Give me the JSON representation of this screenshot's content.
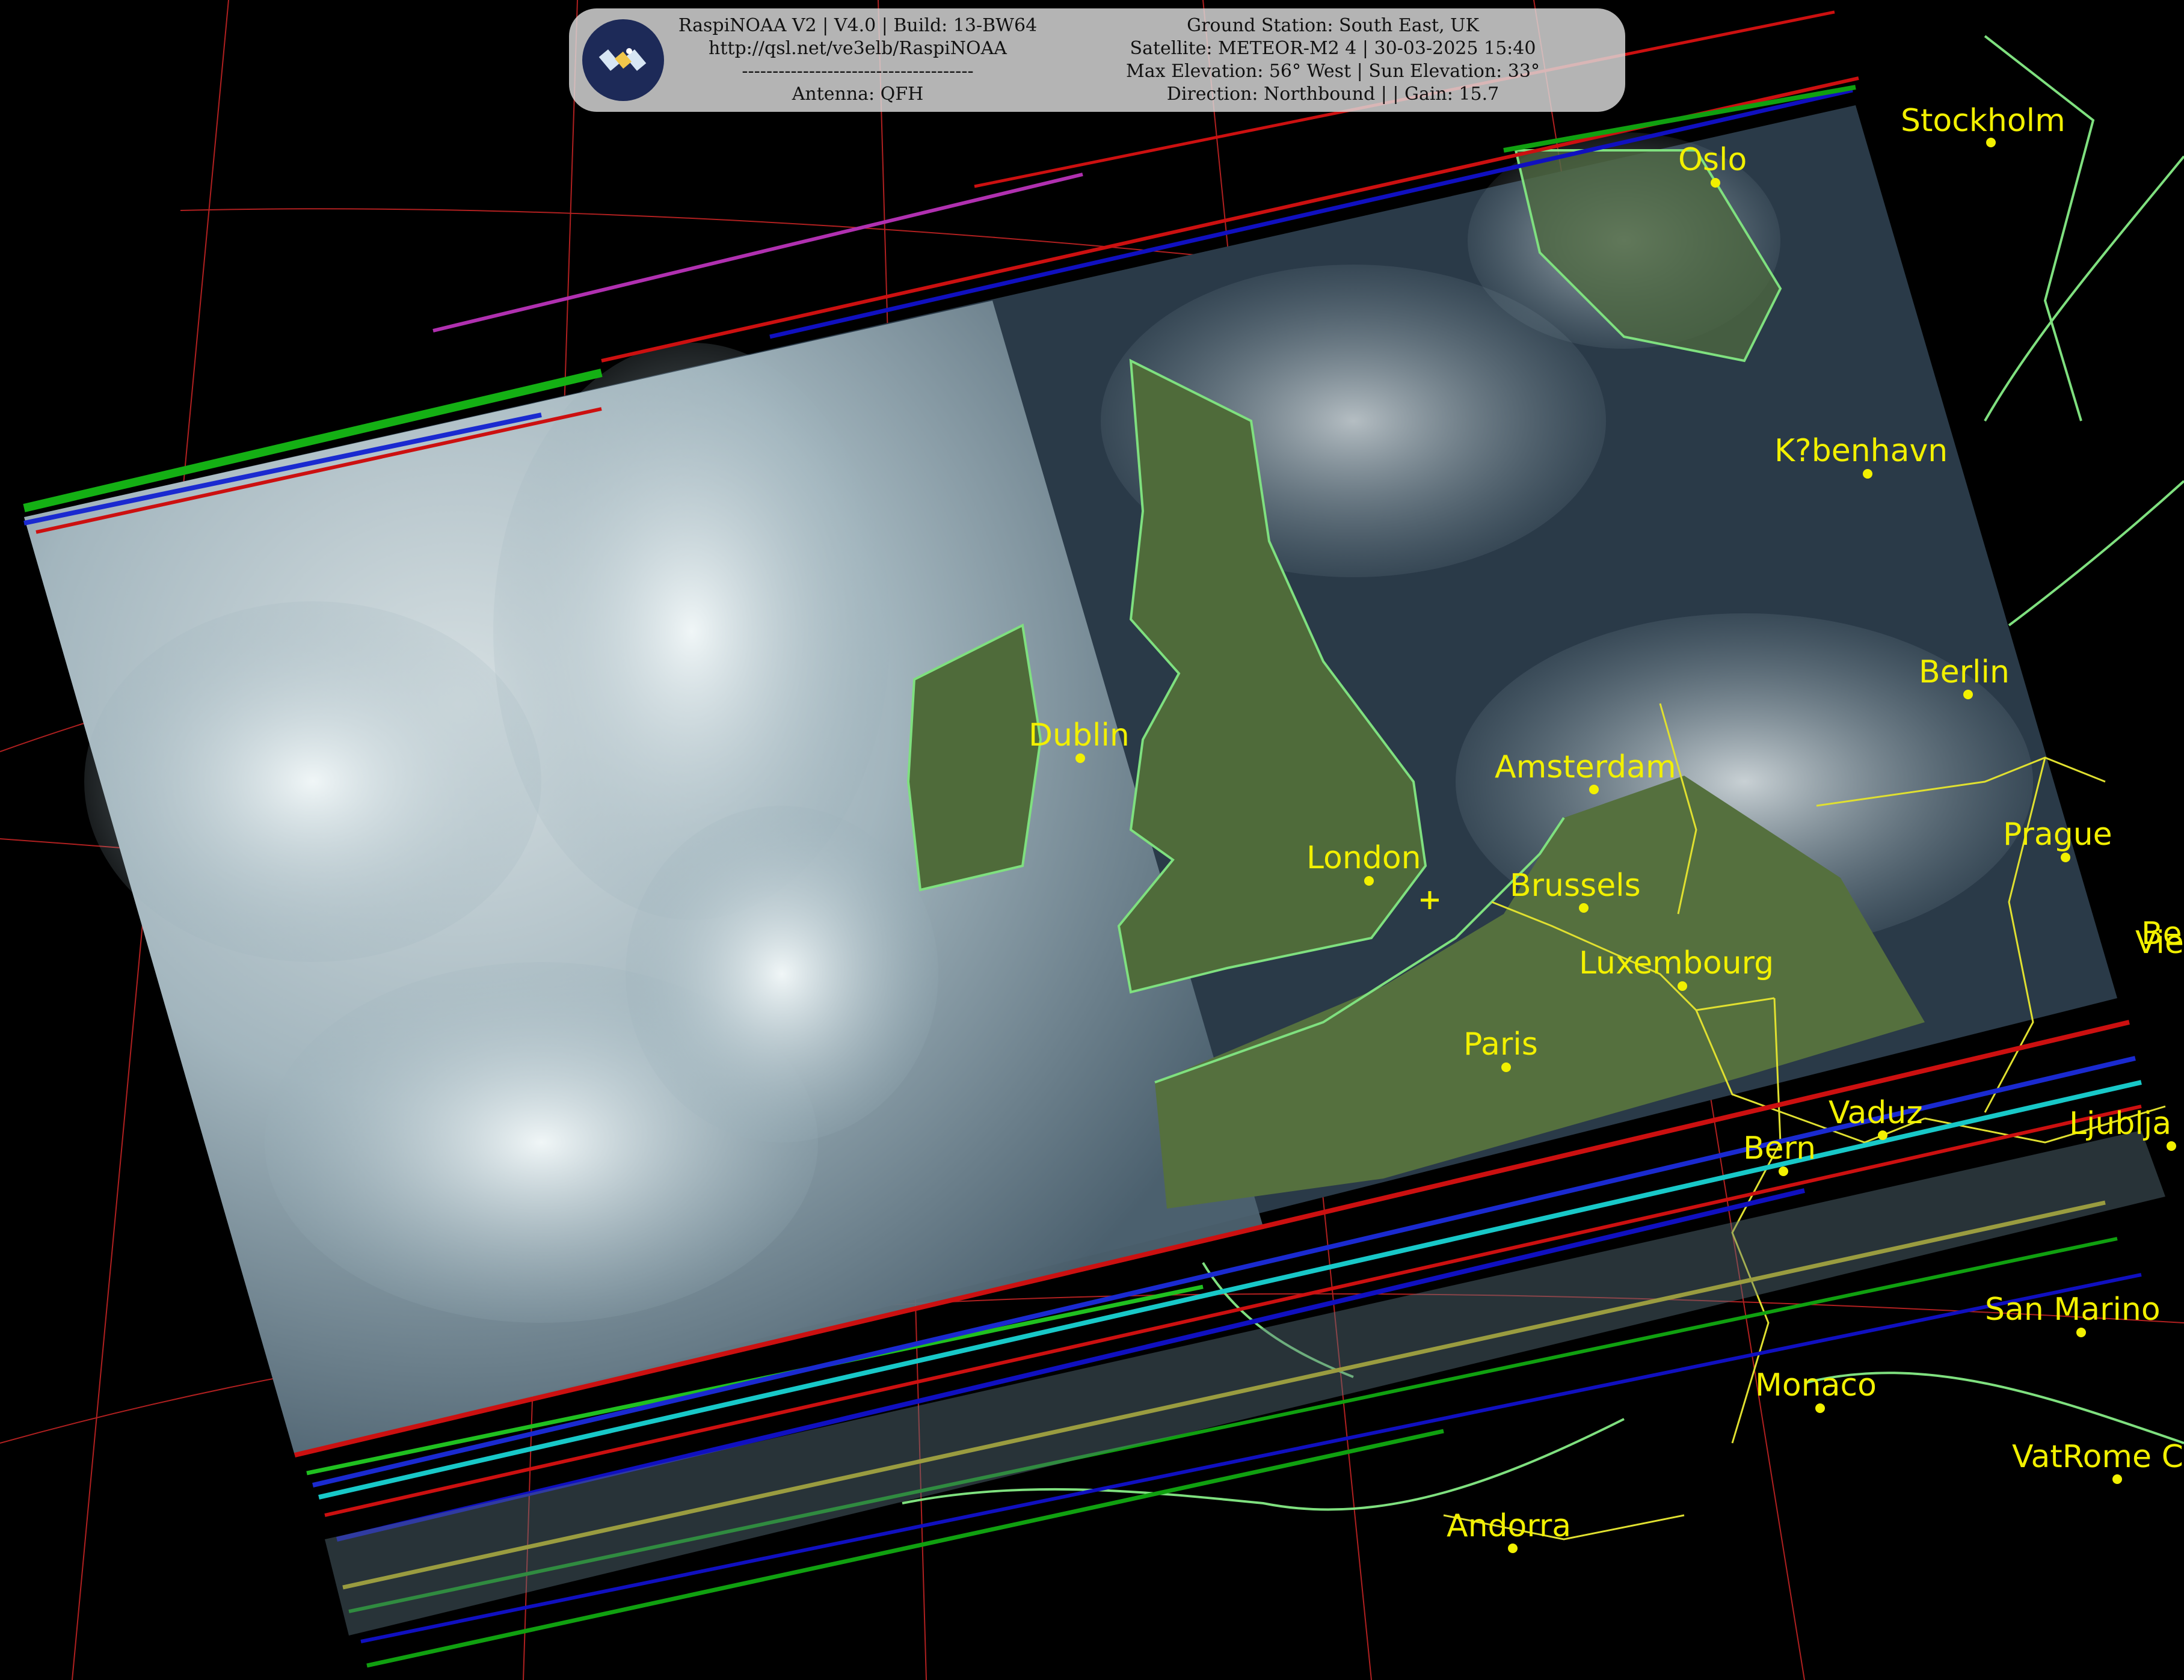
{
  "header": {
    "left_lines": [
      "RaspiNOAA V2 | V4.0 | Build: 13-BW64",
      "http://qsl.net/ve3elb/RaspiNOAA",
      "--------------------------------------",
      "Antenna: QFH"
    ],
    "right_lines": [
      "Ground Station: South East, UK",
      "Satellite: METEOR-M2 4 | 30-03-2025 15:40",
      "Max Elevation: 56° West | Sun Elevation: 33°",
      "Direction: Northbound | | Gain: 15.7"
    ],
    "logo_icon": "satellite-icon"
  },
  "cities": [
    {
      "name": "Stockholm"
    },
    {
      "name": "Oslo"
    },
    {
      "name": "K?benhavn"
    },
    {
      "name": "Berlin"
    },
    {
      "name": "Amsterdam"
    },
    {
      "name": "Dublin"
    },
    {
      "name": "London"
    },
    {
      "name": "Brussels"
    },
    {
      "name": "Prague"
    },
    {
      "name": "Luxembourg"
    },
    {
      "name": "Paris"
    },
    {
      "name": "Vaduz"
    },
    {
      "name": "Bern"
    },
    {
      "name": "Ljublja"
    },
    {
      "name": "San Marino"
    },
    {
      "name": "Monaco"
    },
    {
      "name": "VatRome Ci"
    },
    {
      "name": "Andorra"
    },
    {
      "name": "Be"
    },
    {
      "name": "Vie"
    }
  ],
  "colors": {
    "label": "#f2f000",
    "coastline": "#7fe07f",
    "border": "#e0e030",
    "graticule": "#b02020",
    "header_bg": "#dcdcdc"
  }
}
